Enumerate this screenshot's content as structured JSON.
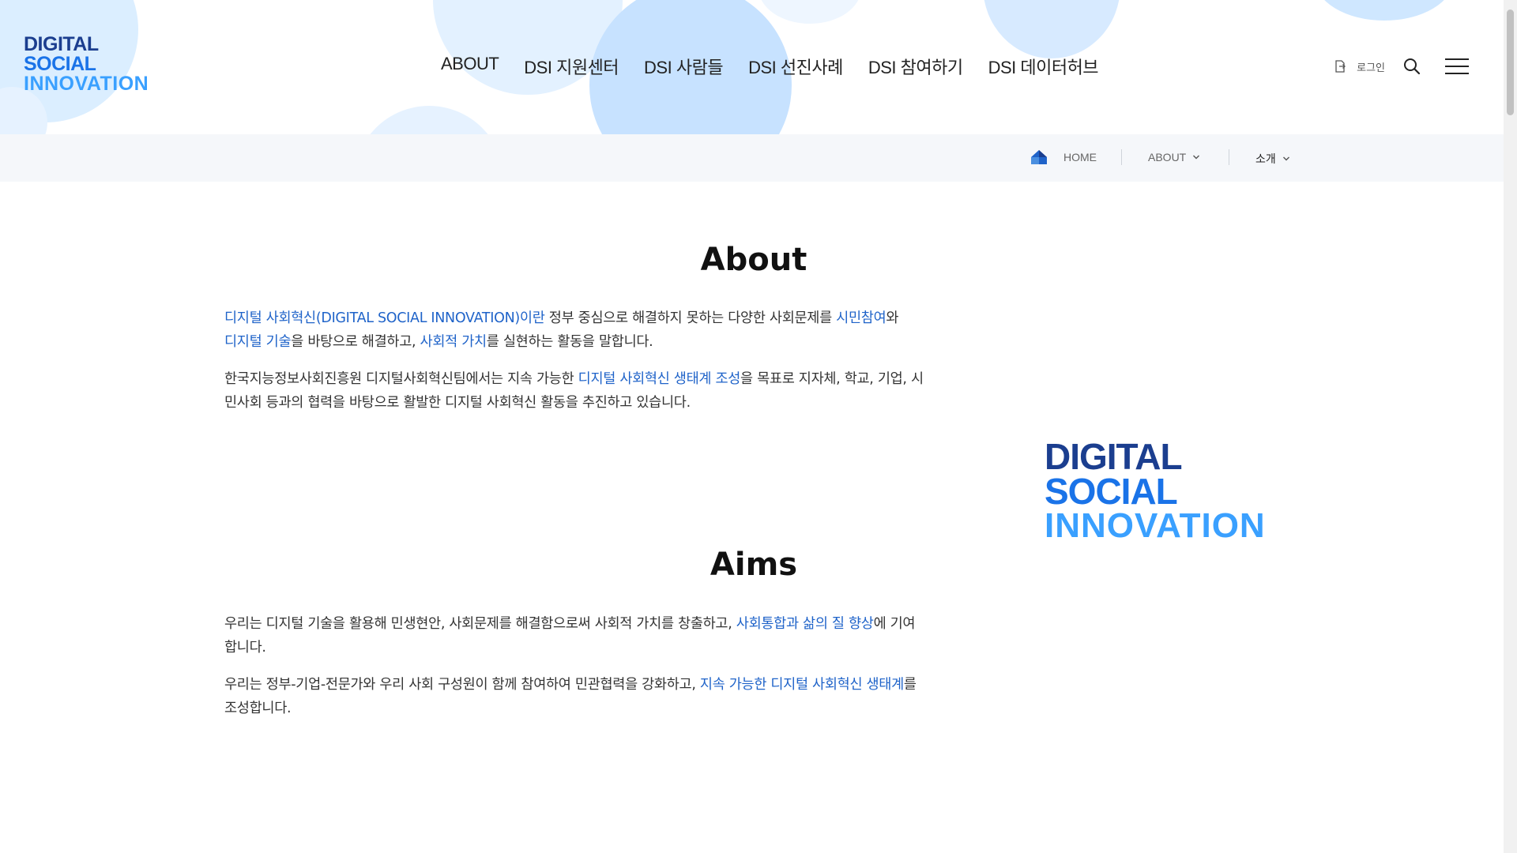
{
  "brand": {
    "logo_lines": [
      "DIGITAL",
      "SOCIAL",
      "INNOVATION"
    ],
    "colors": {
      "navy": "#1b3e8f",
      "blue": "#1a73e8",
      "light_blue": "#3aa0ff",
      "accent": "#1f63c9"
    }
  },
  "nav": {
    "items": [
      "ABOUT",
      "DSI 지원센터",
      "DSI 사람들",
      "DSI 선진사례",
      "DSI 참여하기",
      "DSI 데이터허브"
    ]
  },
  "util": {
    "login_label": "로그인",
    "icons": [
      "login-icon",
      "search-icon",
      "hamburger-menu-icon"
    ]
  },
  "location": {
    "home_label": "HOME",
    "level1": "ABOUT",
    "level2": "소개"
  },
  "about": {
    "title": "About",
    "p1": {
      "s1": "디지털 사회혁신(DIGITAL SOCIAL INNOVATION)이란",
      "s2": " 정부 중심으로 해결하지 못하는 다양한 사회문제를 ",
      "s3": "시민참여",
      "s4": "와",
      "s5": "디지털 기술",
      "s6": "을 바탕으로 해결하고, ",
      "s7": "사회적 가치",
      "s8": "를 실현하는 활동을 말합니다."
    },
    "p2": {
      "s1": "한국지능정보사회진흥원 디지털사회혁신팀에서는 지속 가능한 ",
      "s2": "디지털 사회혁신 생태계 조성",
      "s3": "을 목표로 지자체, 학교, 기업, 시민사회 등과의 협력을 바탕으로 활발한 디지털 사회혁신 활동을 추진하고 있습니다."
    }
  },
  "aims": {
    "title": "Aims",
    "p1": {
      "s1": "우리는 디지털 기술을 활용해 민생현안, 사회문제를 해결함으로써 사회적 가치를 창출하고, ",
      "s2": "사회통합과 삶의 질 향상",
      "s3": "에 기여합니다."
    },
    "p2": {
      "s1": "우리는 정부-기업-전문가와 우리 사회 구성원이 함께 참여하여 민관협력을 강화하고, ",
      "s2": "지속 가능한 디지털 사회혁신 생태계",
      "s3": "를 조성합니다."
    }
  }
}
